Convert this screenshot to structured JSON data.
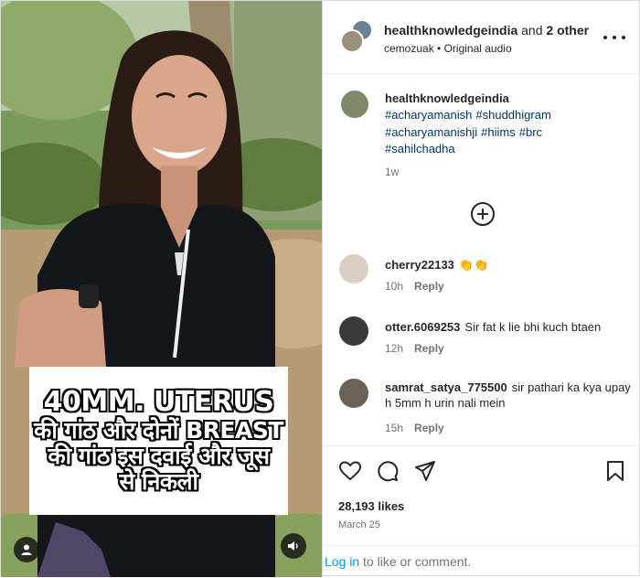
{
  "media": {
    "caption_lines": [
      "40MM.  UTERUS",
      "की गांठ और दोनों BREAST",
      "की गांठ इस दवाई और जूस",
      "से निकली"
    ]
  },
  "header": {
    "username": "healthknowledgeindia",
    "and_text": " and ",
    "others": "2 other",
    "collaborator": "cemozuak",
    "separator": " • ",
    "audio": "Original audio"
  },
  "caption": {
    "username": "healthknowledgeindia",
    "hashtags": [
      "#acharyamanish",
      "#shuddhigram",
      "#acharyamanishji",
      "#hiims",
      "#brc",
      "#sahilchadha"
    ],
    "time": "1w"
  },
  "comments": [
    {
      "username": "cherry22133",
      "text": "👏👏",
      "time": "10h",
      "reply": "Reply"
    },
    {
      "username": "otter.6069253",
      "text": "Sir fat k lie bhi kuch btaen",
      "time": "12h",
      "reply": "Reply"
    },
    {
      "username": "samrat_satya_775500",
      "text": "sir pathari ka kya upay h 5mm h urin nali mein",
      "time": "15h",
      "reply": "Reply"
    }
  ],
  "actions": {
    "likes": "28,193 likes",
    "date": "March 25",
    "login_link": "Log in",
    "login_rest": " to like or comment."
  },
  "icons": [
    "user-tag-icon",
    "speaker-icon",
    "more-options-icon",
    "load-more-comments-icon",
    "heart-icon",
    "comment-icon",
    "share-icon",
    "bookmark-icon"
  ],
  "colors": {
    "link_blue": "#0095f6",
    "hashtag": "#00376b",
    "muted": "#737373",
    "text": "#262626"
  }
}
